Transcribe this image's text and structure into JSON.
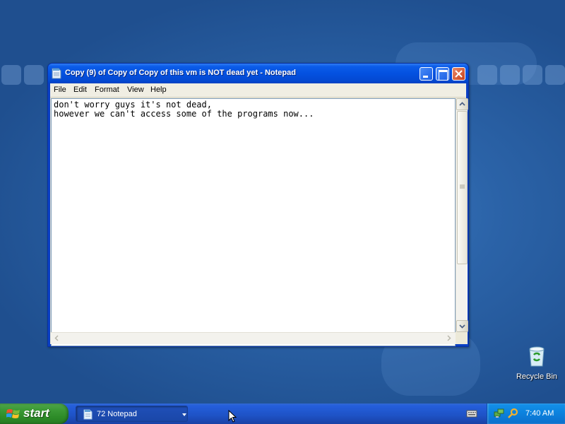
{
  "window": {
    "title": "Copy (9) of Copy of Copy of this vm is NOT dead yet - Notepad",
    "menu": [
      "File",
      "Edit",
      "Format",
      "View",
      "Help"
    ],
    "content": "don't worry guys it's not dead,\nhowever we can't access some of the programs now..."
  },
  "desktop": {
    "recycle_bin_label": "Recycle Bin"
  },
  "taskbar": {
    "start_label": "start",
    "task_label": "72 Notepad",
    "clock": "7:40 AM"
  },
  "icons": [
    "notepad-icon",
    "minimize-icon",
    "maximize-icon",
    "close-icon",
    "recycle-bin-icon",
    "windows-logo-icon",
    "keyboard-icon",
    "network-icon",
    "search-icon",
    "mouse-cursor-icon"
  ],
  "colors": {
    "titlebar": "#0451e0",
    "start_button": "#3c9a36",
    "taskbar": "#245edb",
    "tray": "#0c84e0",
    "close_button": "#c8411b"
  }
}
